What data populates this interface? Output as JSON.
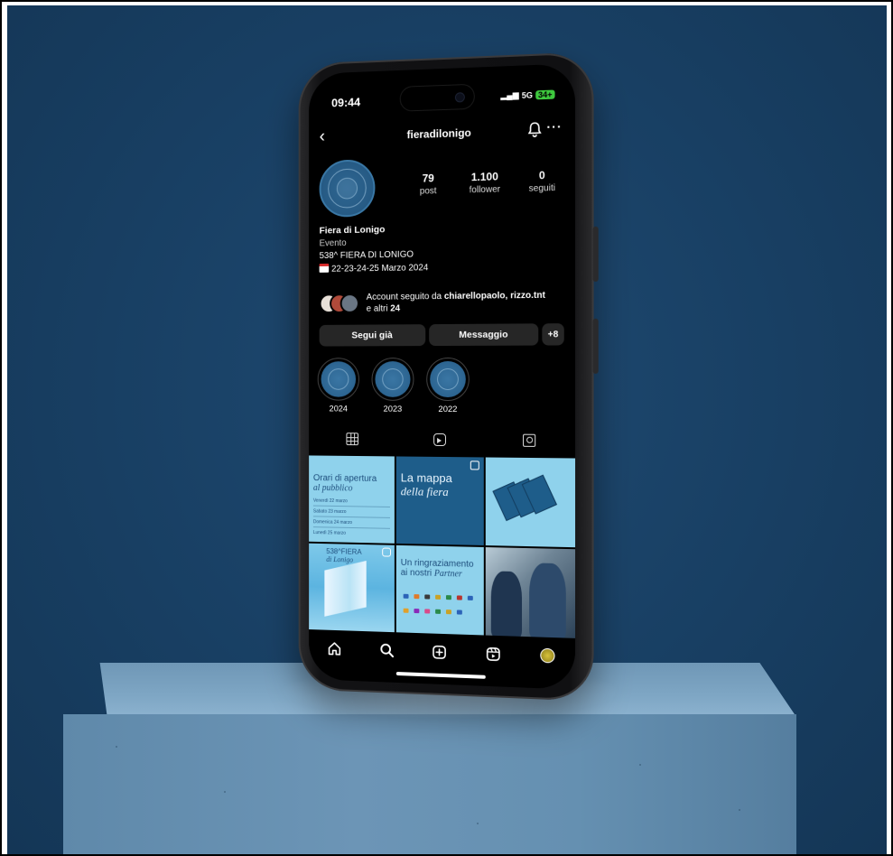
{
  "status": {
    "time": "09:44",
    "network": "5G",
    "battery": "34+"
  },
  "header": {
    "back": "‹",
    "username": "fieradilonigo",
    "more": "···"
  },
  "stats": [
    {
      "num": "79",
      "label": "post"
    },
    {
      "num": "1.100",
      "label": "follower"
    },
    {
      "num": "0",
      "label": "seguiti"
    }
  ],
  "bio": {
    "name": "Fiera di Lonigo",
    "category": "Evento",
    "line1": "538^ FIERA DI LONIGO",
    "line2": "22-23-24-25 Marzo 2024"
  },
  "followed": {
    "prefix": "Account seguito da ",
    "names": "chiarellopaolo, rizzo.tnt",
    "suffix": "e altri ",
    "count": "24"
  },
  "buttons": {
    "follow": "Segui già",
    "message": "Messaggio",
    "add_user": "+8"
  },
  "highlights": [
    {
      "label": "2024"
    },
    {
      "label": "2023"
    },
    {
      "label": "2022"
    }
  ],
  "posts": {
    "p1_title": "Orari di apertura",
    "p1_subtitle": "al pubblico",
    "p1_rows": [
      "Venerdì 22 marzo",
      "Sabato 23 marzo",
      "Domenica 24 marzo",
      "Lunedì 25 marzo"
    ],
    "p2_title": "La mappa",
    "p2_subtitle": "della fiera",
    "p4_title": "538^FIERA",
    "p4_subtitle": "di Lonigo",
    "p5_title": "Un ringraziamento",
    "p5_subtitle": "ai nostri",
    "p5_italic": "Partner"
  },
  "colors": {
    "background": "#183f63",
    "accent_blue": "#2c6490",
    "post_light_blue": "#8fd2ec",
    "battery_green": "#3ec93e"
  }
}
